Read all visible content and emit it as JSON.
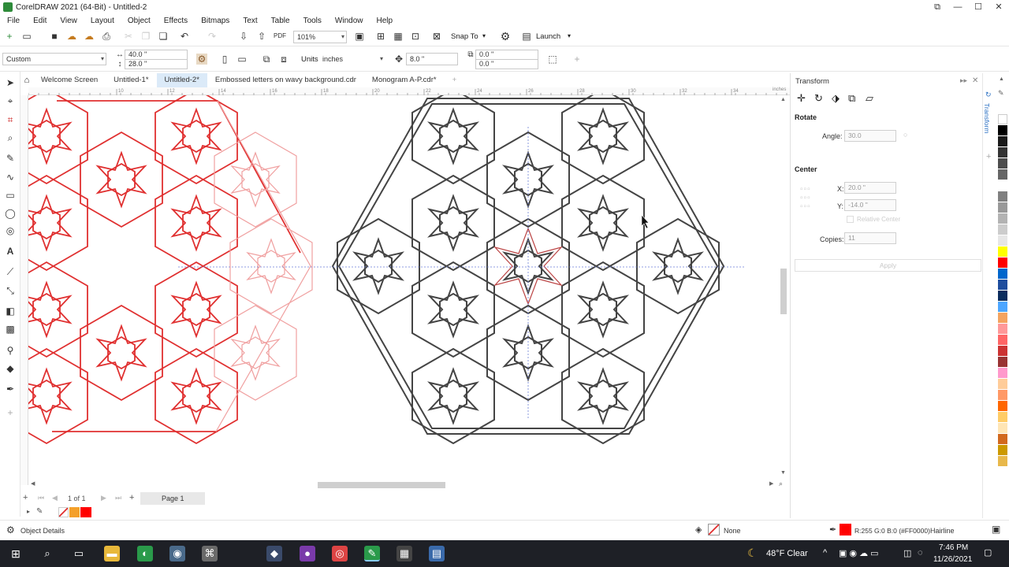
{
  "window": {
    "title": "CorelDRAW 2021 (64-Bit) - Untitled-2",
    "controls": [
      "⧉",
      "—",
      "☐",
      "✕"
    ]
  },
  "menu": [
    "File",
    "Edit",
    "View",
    "Layout",
    "Object",
    "Effects",
    "Bitmaps",
    "Text",
    "Table",
    "Tools",
    "Window",
    "Help"
  ],
  "standard_bar": {
    "zoom": "101%",
    "snap_to": "Snap To",
    "launch": "Launch"
  },
  "property_bar": {
    "page_preset": "Custom",
    "width": "40.0 \"",
    "height": "28.0 \"",
    "units_label": "Units:",
    "units_value": "inches",
    "nudge": "8.0 \"",
    "dup_x": "0.0 \"",
    "dup_y": "0.0 \""
  },
  "tabs": [
    {
      "label": "Welcome Screen",
      "active": false
    },
    {
      "label": "Untitled-1*",
      "active": false
    },
    {
      "label": "Untitled-2*",
      "active": true
    },
    {
      "label": "Embossed letters on wavy background.cdr",
      "active": false
    },
    {
      "label": "Monogram A-P.cdr*",
      "active": false
    }
  ],
  "ruler": {
    "unit": "inches",
    "ticks": [
      "10",
      "12",
      "14",
      "16",
      "18",
      "20",
      "22",
      "24",
      "26",
      "28",
      "30",
      "32",
      "34"
    ]
  },
  "page_nav": {
    "counter": "1 of 1",
    "page_tab": "Page 1"
  },
  "docker": {
    "title": "Transform",
    "side_tab": "Transform",
    "rotate": {
      "heading": "Rotate",
      "angle_label": "Angle:",
      "angle_value": "30.0"
    },
    "center": {
      "heading": "Center",
      "x_label": "X:",
      "x_value": "20.0 \"",
      "y_label": "Y:",
      "y_value": "-14.0 \"",
      "relative_label": "Relative Center"
    },
    "copies_label": "Copies:",
    "copies_value": "11",
    "apply_label": "Apply"
  },
  "status": {
    "object_details": "Object Details",
    "fill_label": "None",
    "outline_info": "R:255 G:0 B:0 (#FF0000)",
    "outline_width": "Hairline"
  },
  "taskbar": {
    "weather": "48°F  Clear",
    "time": "7:46 PM",
    "date": "11/26/2021"
  },
  "palette_colors": [
    "#ffffff",
    "#000000",
    "#1a1a1a",
    "#333333",
    "#4d4d4d",
    "#666666",
    "#ffffff",
    "#808080",
    "#999999",
    "#b3b3b3",
    "#cccccc",
    "#e6e6e6",
    "#ffff00",
    "#ff0000",
    "#0066cc",
    "#1f4e9e",
    "#0b2d5e",
    "#4da6ff",
    "#f4a460",
    "#ff9999",
    "#ff6666",
    "#cc3333",
    "#993333",
    "#ff99cc",
    "#ffcc99",
    "#ff9966",
    "#ff6600",
    "#ffcc66",
    "#ffe5b4",
    "#d2691e",
    "#cc9900",
    "#e8b84b"
  ]
}
